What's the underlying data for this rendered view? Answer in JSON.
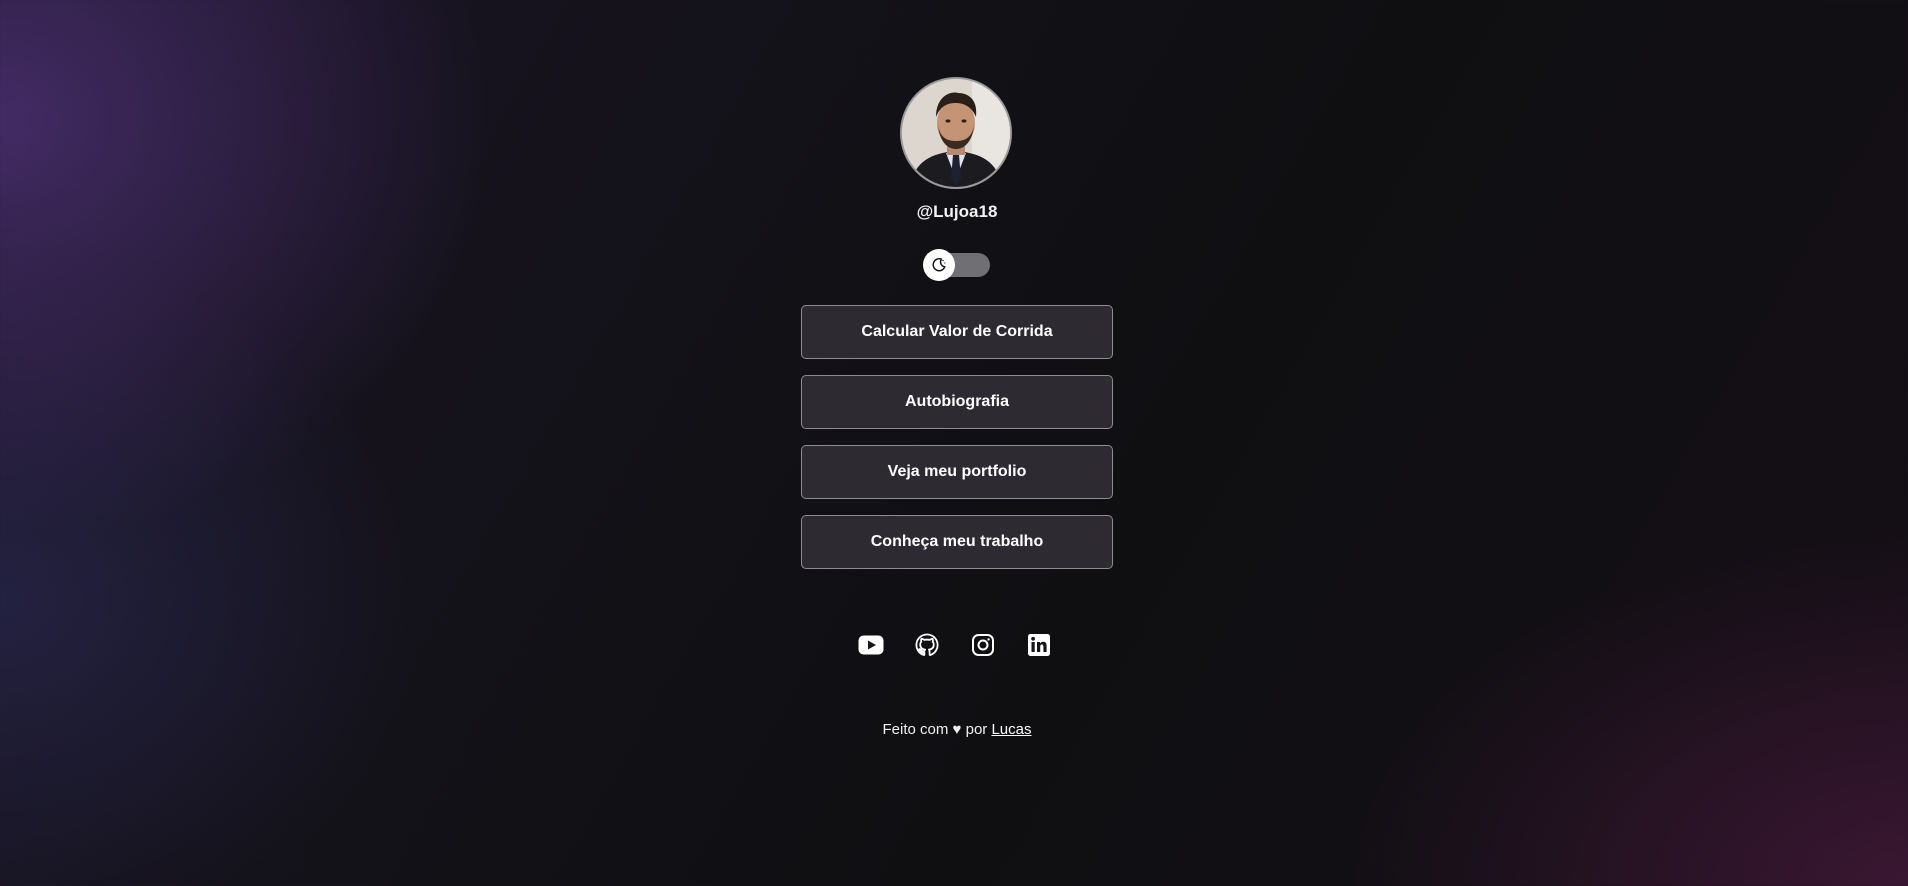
{
  "profile": {
    "username": "@Lujoa18",
    "avatar_alt": "profile-photo"
  },
  "theme_toggle": {
    "icon": "moon-icon",
    "state": "off"
  },
  "links": [
    {
      "label": "Calcular Valor de Corrida"
    },
    {
      "label": "Autobiografia"
    },
    {
      "label": "Veja meu portfolio"
    },
    {
      "label": "Conheça meu trabalho"
    }
  ],
  "social": [
    {
      "icon": "youtube-icon"
    },
    {
      "icon": "github-icon"
    },
    {
      "icon": "instagram-icon"
    },
    {
      "icon": "linkedin-icon"
    }
  ],
  "footer": {
    "prefix": "Feito com",
    "heart": "♥",
    "by": "por",
    "author": "Lucas"
  },
  "colors": {
    "button_bg": "#302e34",
    "button_border": "#8e8c92",
    "toggle_track": "#6f6f74"
  }
}
